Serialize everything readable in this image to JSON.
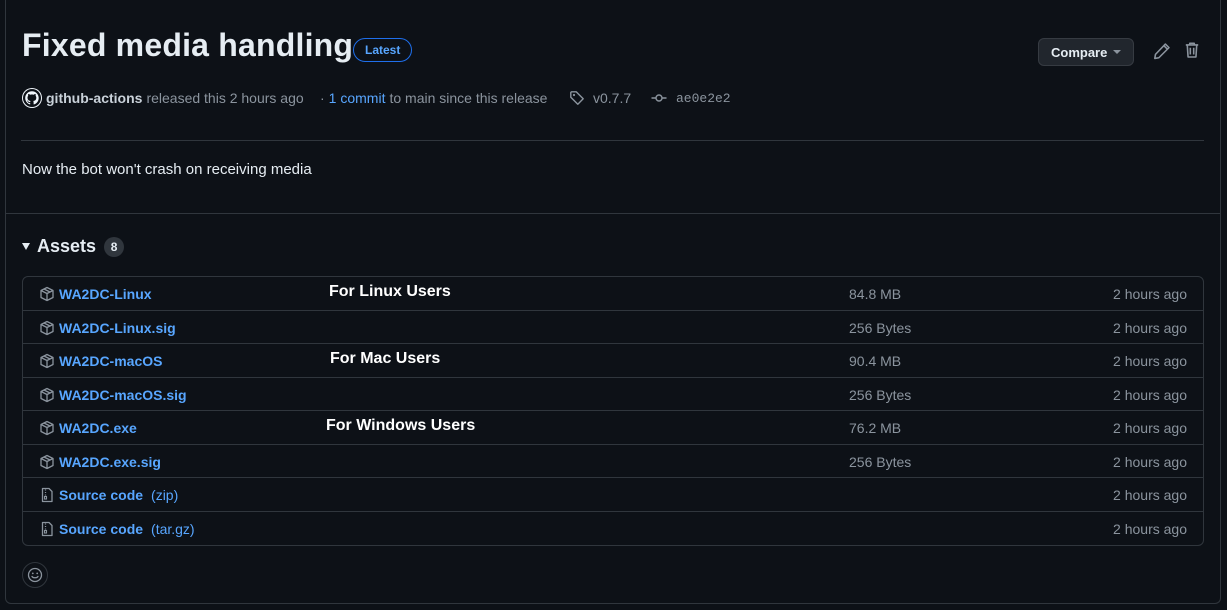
{
  "release": {
    "title": "Fixed media handling",
    "badge": "Latest",
    "author": "github-actions",
    "released_text": "released this 2 hours ago",
    "commits_prefix": "·",
    "commits_link": "1 commit",
    "commits_suffix": "to main since this release",
    "tag": "v0.7.7",
    "commit_sha": "ae0e2e2",
    "notes": "Now the bot won't crash on receiving media"
  },
  "toolbar": {
    "compare_label": "Compare"
  },
  "assets": {
    "heading": "Assets",
    "count": "8",
    "rows": [
      {
        "name": "WA2DC-Linux",
        "suffix": "",
        "note": "For Linux Users",
        "size": "84.8 MB",
        "time": "2 hours ago",
        "icon": "package-icon"
      },
      {
        "name": "WA2DC-Linux.sig",
        "suffix": "",
        "note": "",
        "size": "256 Bytes",
        "time": "2 hours ago",
        "icon": "package-icon"
      },
      {
        "name": "WA2DC-macOS",
        "suffix": "",
        "note": "For Mac Users",
        "size": "90.4 MB",
        "time": "2 hours ago",
        "icon": "package-icon"
      },
      {
        "name": "WA2DC-macOS.sig",
        "suffix": "",
        "note": "",
        "size": "256 Bytes",
        "time": "2 hours ago",
        "icon": "package-icon"
      },
      {
        "name": "WA2DC.exe",
        "suffix": "",
        "note": "For Windows Users",
        "size": "76.2 MB",
        "time": "2 hours ago",
        "icon": "package-icon"
      },
      {
        "name": "WA2DC.exe.sig",
        "suffix": "",
        "note": "",
        "size": "256 Bytes",
        "time": "2 hours ago",
        "icon": "package-icon"
      },
      {
        "name": "Source code",
        "suffix": "(zip)",
        "note": "",
        "size": "",
        "time": "2 hours ago",
        "icon": "file-zip-icon"
      },
      {
        "name": "Source code",
        "suffix": "(tar.gz)",
        "note": "",
        "size": "",
        "time": "2 hours ago",
        "icon": "file-zip-icon"
      }
    ]
  },
  "colors": {
    "background": "#0d1117",
    "border": "#30363d",
    "link": "#58a6ff",
    "muted": "#8b949e",
    "text": "#e6edf3"
  }
}
